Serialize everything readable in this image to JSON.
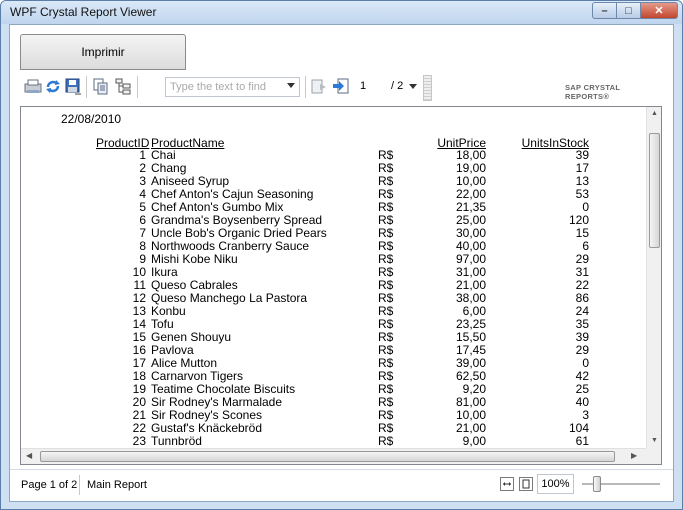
{
  "window": {
    "title": "WPF Crystal Report Viewer",
    "controls": {
      "minimize": "–",
      "maximize": "□",
      "close": "✕"
    }
  },
  "print_button": {
    "label": "Imprimir"
  },
  "toolbar": {
    "icons": [
      "export-icon",
      "refresh-icon",
      "save-icon",
      "copy-icon",
      "group-tree-icon",
      "find-next-icon",
      "go-to-page-icon"
    ],
    "search_placeholder": "Type the text to find",
    "current_page": "1",
    "total_pages": "/ 2",
    "brand": "SAP CRYSTAL REPORTS®"
  },
  "report": {
    "date": "22/08/2010",
    "headers": {
      "id": "ProductID",
      "name": "ProductName",
      "price": "UnitPrice",
      "stock": "UnitsInStock"
    },
    "rows": [
      {
        "id": "1",
        "name": "Chai",
        "cur": "R$",
        "price": "18,00",
        "stock": "39"
      },
      {
        "id": "2",
        "name": "Chang",
        "cur": "R$",
        "price": "19,00",
        "stock": "17"
      },
      {
        "id": "3",
        "name": "Aniseed Syrup",
        "cur": "R$",
        "price": "10,00",
        "stock": "13"
      },
      {
        "id": "4",
        "name": "Chef Anton's Cajun Seasoning",
        "cur": "R$",
        "price": "22,00",
        "stock": "53"
      },
      {
        "id": "5",
        "name": "Chef Anton's Gumbo Mix",
        "cur": "R$",
        "price": "21,35",
        "stock": "0"
      },
      {
        "id": "6",
        "name": "Grandma's Boysenberry Spread",
        "cur": "R$",
        "price": "25,00",
        "stock": "120"
      },
      {
        "id": "7",
        "name": "Uncle Bob's Organic Dried Pears",
        "cur": "R$",
        "price": "30,00",
        "stock": "15"
      },
      {
        "id": "8",
        "name": "Northwoods Cranberry Sauce",
        "cur": "R$",
        "price": "40,00",
        "stock": "6"
      },
      {
        "id": "9",
        "name": "Mishi Kobe Niku",
        "cur": "R$",
        "price": "97,00",
        "stock": "29"
      },
      {
        "id": "10",
        "name": "Ikura",
        "cur": "R$",
        "price": "31,00",
        "stock": "31"
      },
      {
        "id": "11",
        "name": "Queso Cabrales",
        "cur": "R$",
        "price": "21,00",
        "stock": "22"
      },
      {
        "id": "12",
        "name": "Queso Manchego La Pastora",
        "cur": "R$",
        "price": "38,00",
        "stock": "86"
      },
      {
        "id": "13",
        "name": "Konbu",
        "cur": "R$",
        "price": "6,00",
        "stock": "24"
      },
      {
        "id": "14",
        "name": "Tofu",
        "cur": "R$",
        "price": "23,25",
        "stock": "35"
      },
      {
        "id": "15",
        "name": "Genen Shouyu",
        "cur": "R$",
        "price": "15,50",
        "stock": "39"
      },
      {
        "id": "16",
        "name": "Pavlova",
        "cur": "R$",
        "price": "17,45",
        "stock": "29"
      },
      {
        "id": "17",
        "name": "Alice Mutton",
        "cur": "R$",
        "price": "39,00",
        "stock": "0"
      },
      {
        "id": "18",
        "name": "Carnarvon Tigers",
        "cur": "R$",
        "price": "62,50",
        "stock": "42"
      },
      {
        "id": "19",
        "name": "Teatime Chocolate Biscuits",
        "cur": "R$",
        "price": "9,20",
        "stock": "25"
      },
      {
        "id": "20",
        "name": "Sir Rodney's Marmalade",
        "cur": "R$",
        "price": "81,00",
        "stock": "40"
      },
      {
        "id": "21",
        "name": "Sir Rodney's Scones",
        "cur": "R$",
        "price": "10,00",
        "stock": "3"
      },
      {
        "id": "22",
        "name": "Gustaf's Knäckebröd",
        "cur": "R$",
        "price": "21,00",
        "stock": "104"
      },
      {
        "id": "23",
        "name": "Tunnbröd",
        "cur": "R$",
        "price": "9,00",
        "stock": "61"
      }
    ]
  },
  "statusbar": {
    "page_info": "Page 1 of 2",
    "report_name": "Main Report",
    "zoom": "100%"
  }
}
